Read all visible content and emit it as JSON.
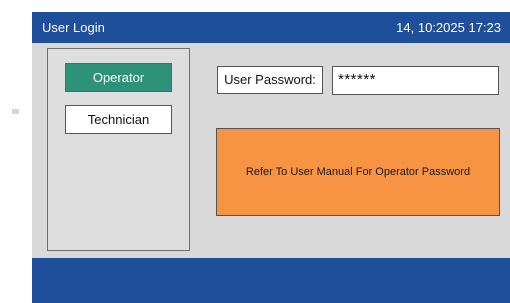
{
  "title_bar": {
    "title": "User Login",
    "datetime": "14, 10:2025 17:23"
  },
  "roles": {
    "operator": "Operator",
    "technician": "Technician",
    "selected": "Operator"
  },
  "password": {
    "label": "User Password:",
    "value": "******"
  },
  "notice": {
    "text": "Refer To User Manual For Operator Password"
  },
  "colors": {
    "title_bar": "#1f4e9a",
    "panel": "#d9d9d9",
    "operator_selected": "#2e9278",
    "notice": "#f79444"
  }
}
